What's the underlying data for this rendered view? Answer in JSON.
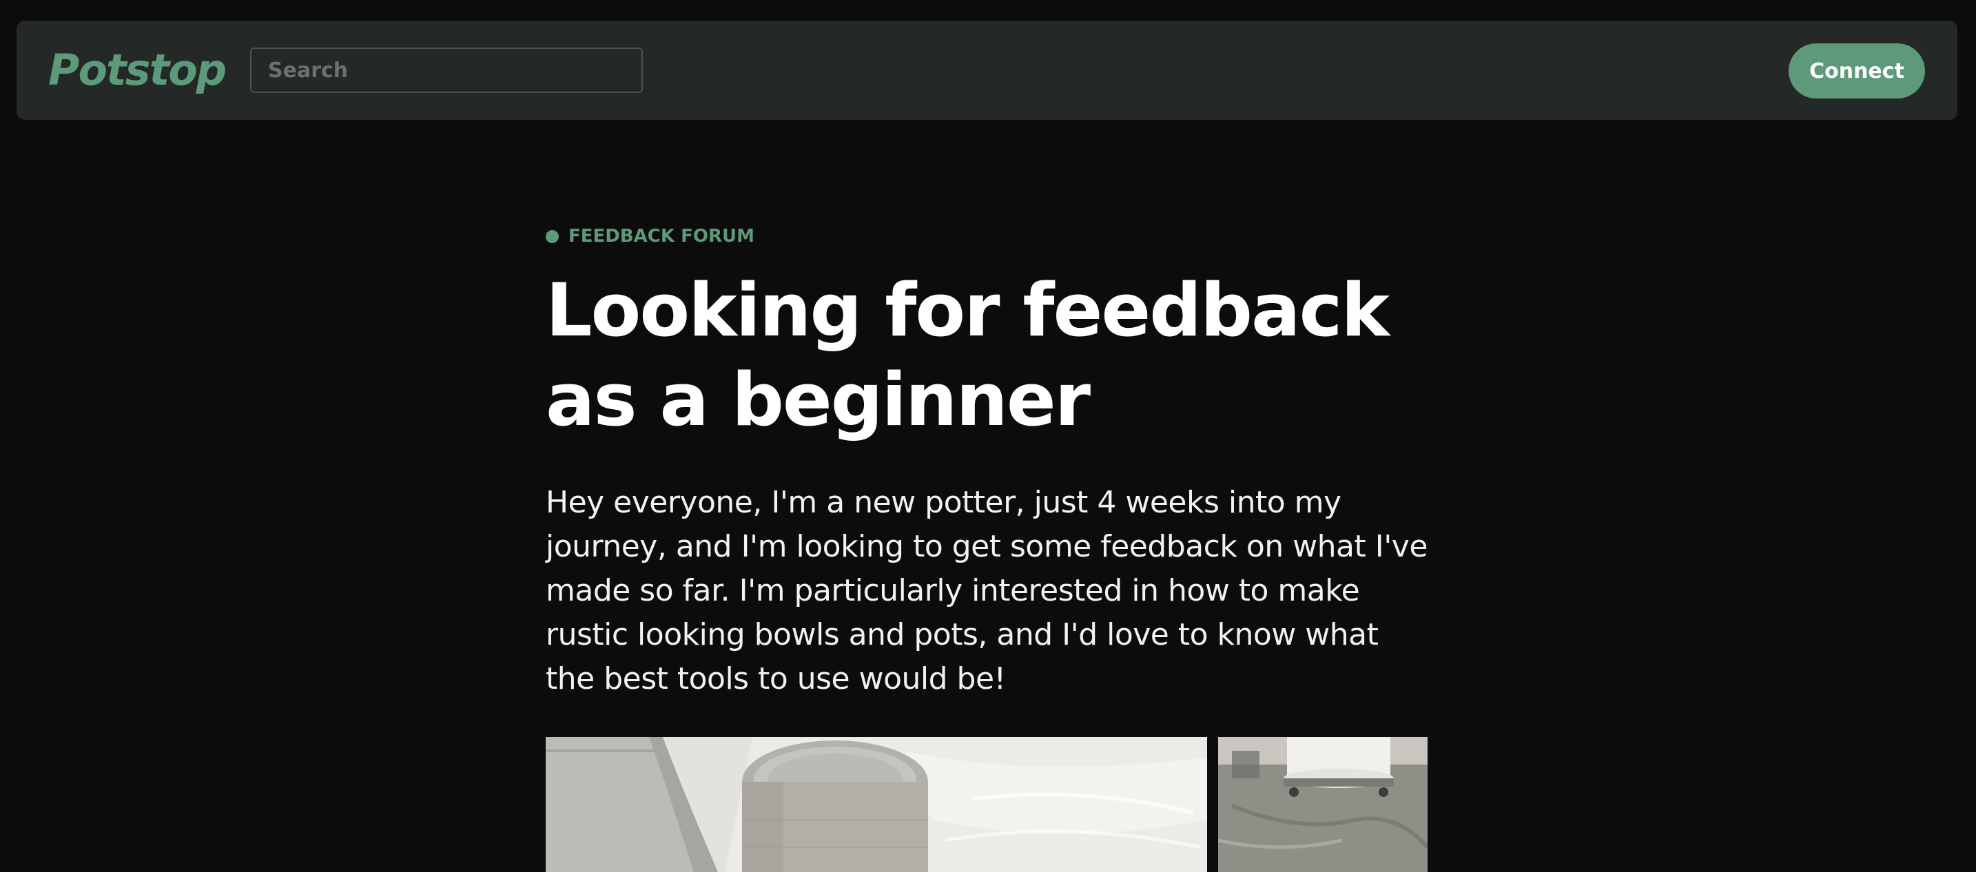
{
  "app": {
    "brand": "Potstop",
    "accent_color": "#5c9a79"
  },
  "header": {
    "search_placeholder": "Search",
    "connect_label": "Connect"
  },
  "post": {
    "category": "FEEDBACK FORUM",
    "title": "Looking for feedback as a beginner",
    "body": "Hey everyone, I'm a new potter, just 4 weeks into my journey, and I'm looking to get some feedback on what I've made so far. I'm particularly interested in how to make rustic looking bowls and pots, and I'd love to know what the best tools to use would be!"
  },
  "gallery": {
    "images": [
      {
        "icon": "pottery-photo"
      },
      {
        "icon": "pottery-wheel-photo"
      }
    ]
  }
}
